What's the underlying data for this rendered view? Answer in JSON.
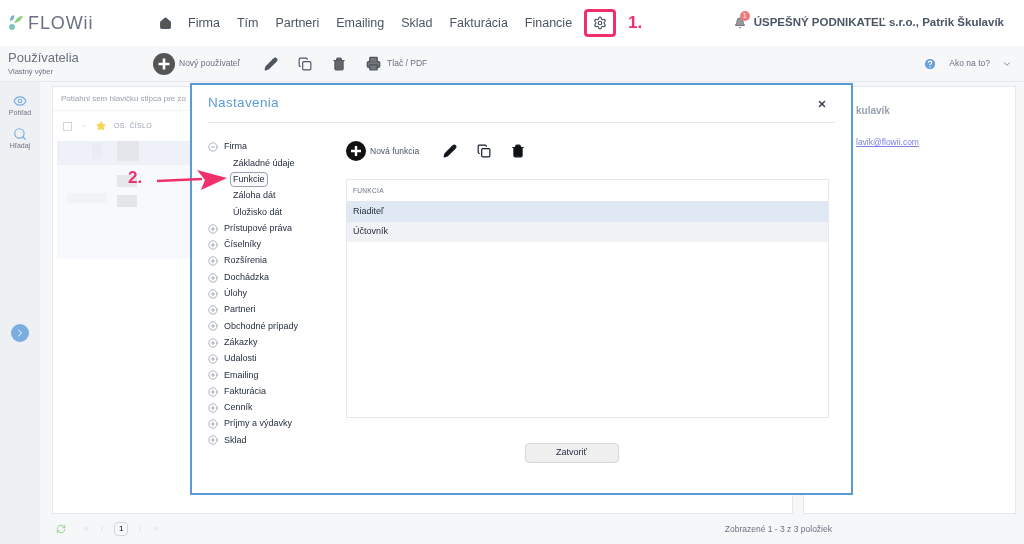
{
  "logo": {
    "text": "FLOWii"
  },
  "nav": [
    {
      "label": "Firma"
    },
    {
      "label": "Tím"
    },
    {
      "label": "Partneri"
    },
    {
      "label": "Emailing"
    },
    {
      "label": "Sklad"
    },
    {
      "label": "Fakturácia"
    },
    {
      "label": "Financie"
    }
  ],
  "settings_highlighted": true,
  "annotations": [
    {
      "label": "1."
    },
    {
      "label": "2."
    }
  ],
  "notifications": {
    "count": "1"
  },
  "account": "ÚSPEŠNÝ PODNIKATEĽ s.r.o., Patrik Škulavík",
  "page": {
    "title": "Používatelia",
    "subtitle": "Vlastný výber"
  },
  "toolbar": {
    "new": "Nový používateľ",
    "print": "Tlač / PDF",
    "help": "Ako na to?"
  },
  "rail": [
    {
      "label": "Pohľad",
      "kind": "eye"
    },
    {
      "label": "Hľadaj",
      "kind": "search"
    }
  ],
  "grid": {
    "group_hint": "Potiahni sem hlavičku stĺpca pre zo",
    "column": "OS. ČÍSLO",
    "select_all": false
  },
  "detail": {
    "name": "kulavík",
    "email": "lavik@flowii.com"
  },
  "footer": {
    "page": "1",
    "summary": "Zobrazené 1 - 3 z 3 položiek"
  },
  "dialog": {
    "title": "Nastavenia",
    "tree": [
      {
        "label": "Firma",
        "expanded": true,
        "children": [
          {
            "label": "Základné údaje",
            "selected": false
          },
          {
            "label": "Funkcie",
            "selected": true
          },
          {
            "label": "Záloha dát",
            "selected": false
          },
          {
            "label": "Úložisko dát",
            "selected": false
          }
        ]
      },
      {
        "label": "Prístupové práva",
        "expanded": false
      },
      {
        "label": "Číselníky",
        "expanded": false
      },
      {
        "label": "Rozšírenia",
        "expanded": false
      },
      {
        "label": "Dochádzka",
        "expanded": false
      },
      {
        "label": "Úlohy",
        "expanded": false
      },
      {
        "label": "Partneri",
        "expanded": false
      },
      {
        "label": "Obchodné prípady",
        "expanded": false
      },
      {
        "label": "Zákazky",
        "expanded": false
      },
      {
        "label": "Udalosti",
        "expanded": false
      },
      {
        "label": "Emailing",
        "expanded": false
      },
      {
        "label": "Fakturácia",
        "expanded": false
      },
      {
        "label": "Cenník",
        "expanded": false
      },
      {
        "label": "Príjmy a výdavky",
        "expanded": false
      },
      {
        "label": "Sklad",
        "expanded": false
      }
    ],
    "new_button": "Nová funkcia",
    "table": {
      "column": "FUNKCIA",
      "rows": [
        {
          "name": "Riaditeľ",
          "selected": true
        },
        {
          "name": "Účtovník",
          "selected": false
        }
      ]
    },
    "close_button": "Zatvoriť"
  }
}
